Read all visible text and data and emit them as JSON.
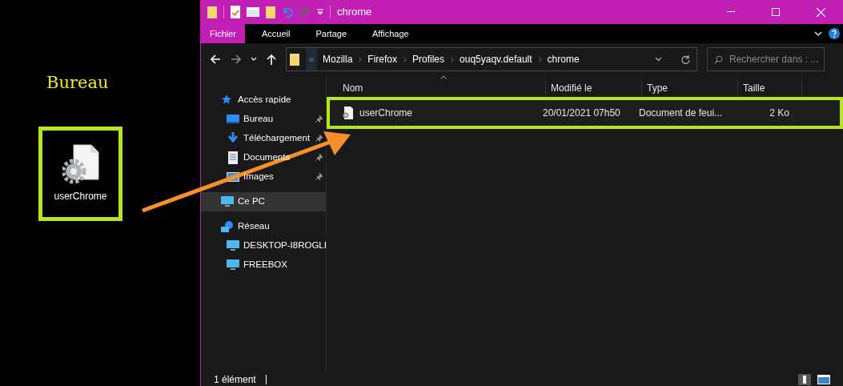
{
  "desktop": {
    "title": "Bureau",
    "icon": {
      "label": "userChrome",
      "highlighted": true
    }
  },
  "window": {
    "title": "chrome"
  },
  "ribbon_tabs": [
    {
      "label": "Fichier",
      "selected": true
    },
    {
      "label": "Accueil",
      "selected": false
    },
    {
      "label": "Partage",
      "selected": false
    },
    {
      "label": "Affichage",
      "selected": false
    }
  ],
  "breadcrumb": [
    "Mozilla",
    "Firefox",
    "Profiles",
    "ouq5yaqv.default",
    "chrome"
  ],
  "search": {
    "placeholder": "Rechercher dans : ..."
  },
  "sidebar": {
    "items": [
      {
        "label": "Accès rapide",
        "kind": "star",
        "selected": false,
        "children": [
          {
            "label": "Bureau",
            "kind": "desktop",
            "selected": false,
            "pinned": true
          },
          {
            "label": "Téléchargement",
            "kind": "download",
            "selected": false,
            "pinned": true
          },
          {
            "label": "Documents",
            "kind": "document",
            "selected": false,
            "pinned": true
          },
          {
            "label": "Images",
            "kind": "image",
            "selected": false,
            "pinned": true
          }
        ]
      },
      {
        "label": "Ce PC",
        "kind": "pc",
        "selected": true
      },
      {
        "label": "Réseau",
        "kind": "network",
        "selected": false,
        "children": [
          {
            "label": "DESKTOP-I8ROGLI",
            "kind": "pc",
            "selected": false,
            "pinned": false
          },
          {
            "label": "FREEBOX",
            "kind": "pc",
            "selected": false,
            "pinned": false
          }
        ]
      }
    ]
  },
  "table": {
    "columns": [
      "Nom",
      "Modifié le",
      "Type",
      "Taille"
    ],
    "rows": [
      {
        "cells": [
          "userChrome",
          "20/01/2021 07h50",
          "Document de feui...",
          "2 Ko"
        ],
        "highlighted": true
      }
    ]
  },
  "status_bar": {
    "text": "1 élément"
  }
}
